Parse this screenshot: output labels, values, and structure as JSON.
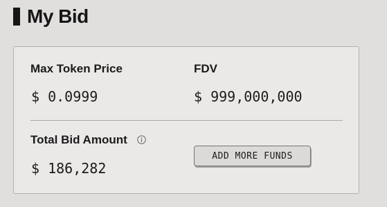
{
  "header": {
    "title": "My Bid"
  },
  "bid": {
    "max_token_price": {
      "label": "Max Token Price",
      "value": "$ 0.0999"
    },
    "fdv": {
      "label": "FDV",
      "value": "$ 999,000,000"
    },
    "total_bid_amount": {
      "label": "Total Bid Amount",
      "value": "$ 186,282",
      "icon": "info-icon"
    },
    "add_funds_label": "ADD MORE FUNDS"
  },
  "colors": {
    "background": "#e1dfde",
    "card": "#ebe9e8",
    "text": "#161616",
    "button": "#dcdad9"
  }
}
